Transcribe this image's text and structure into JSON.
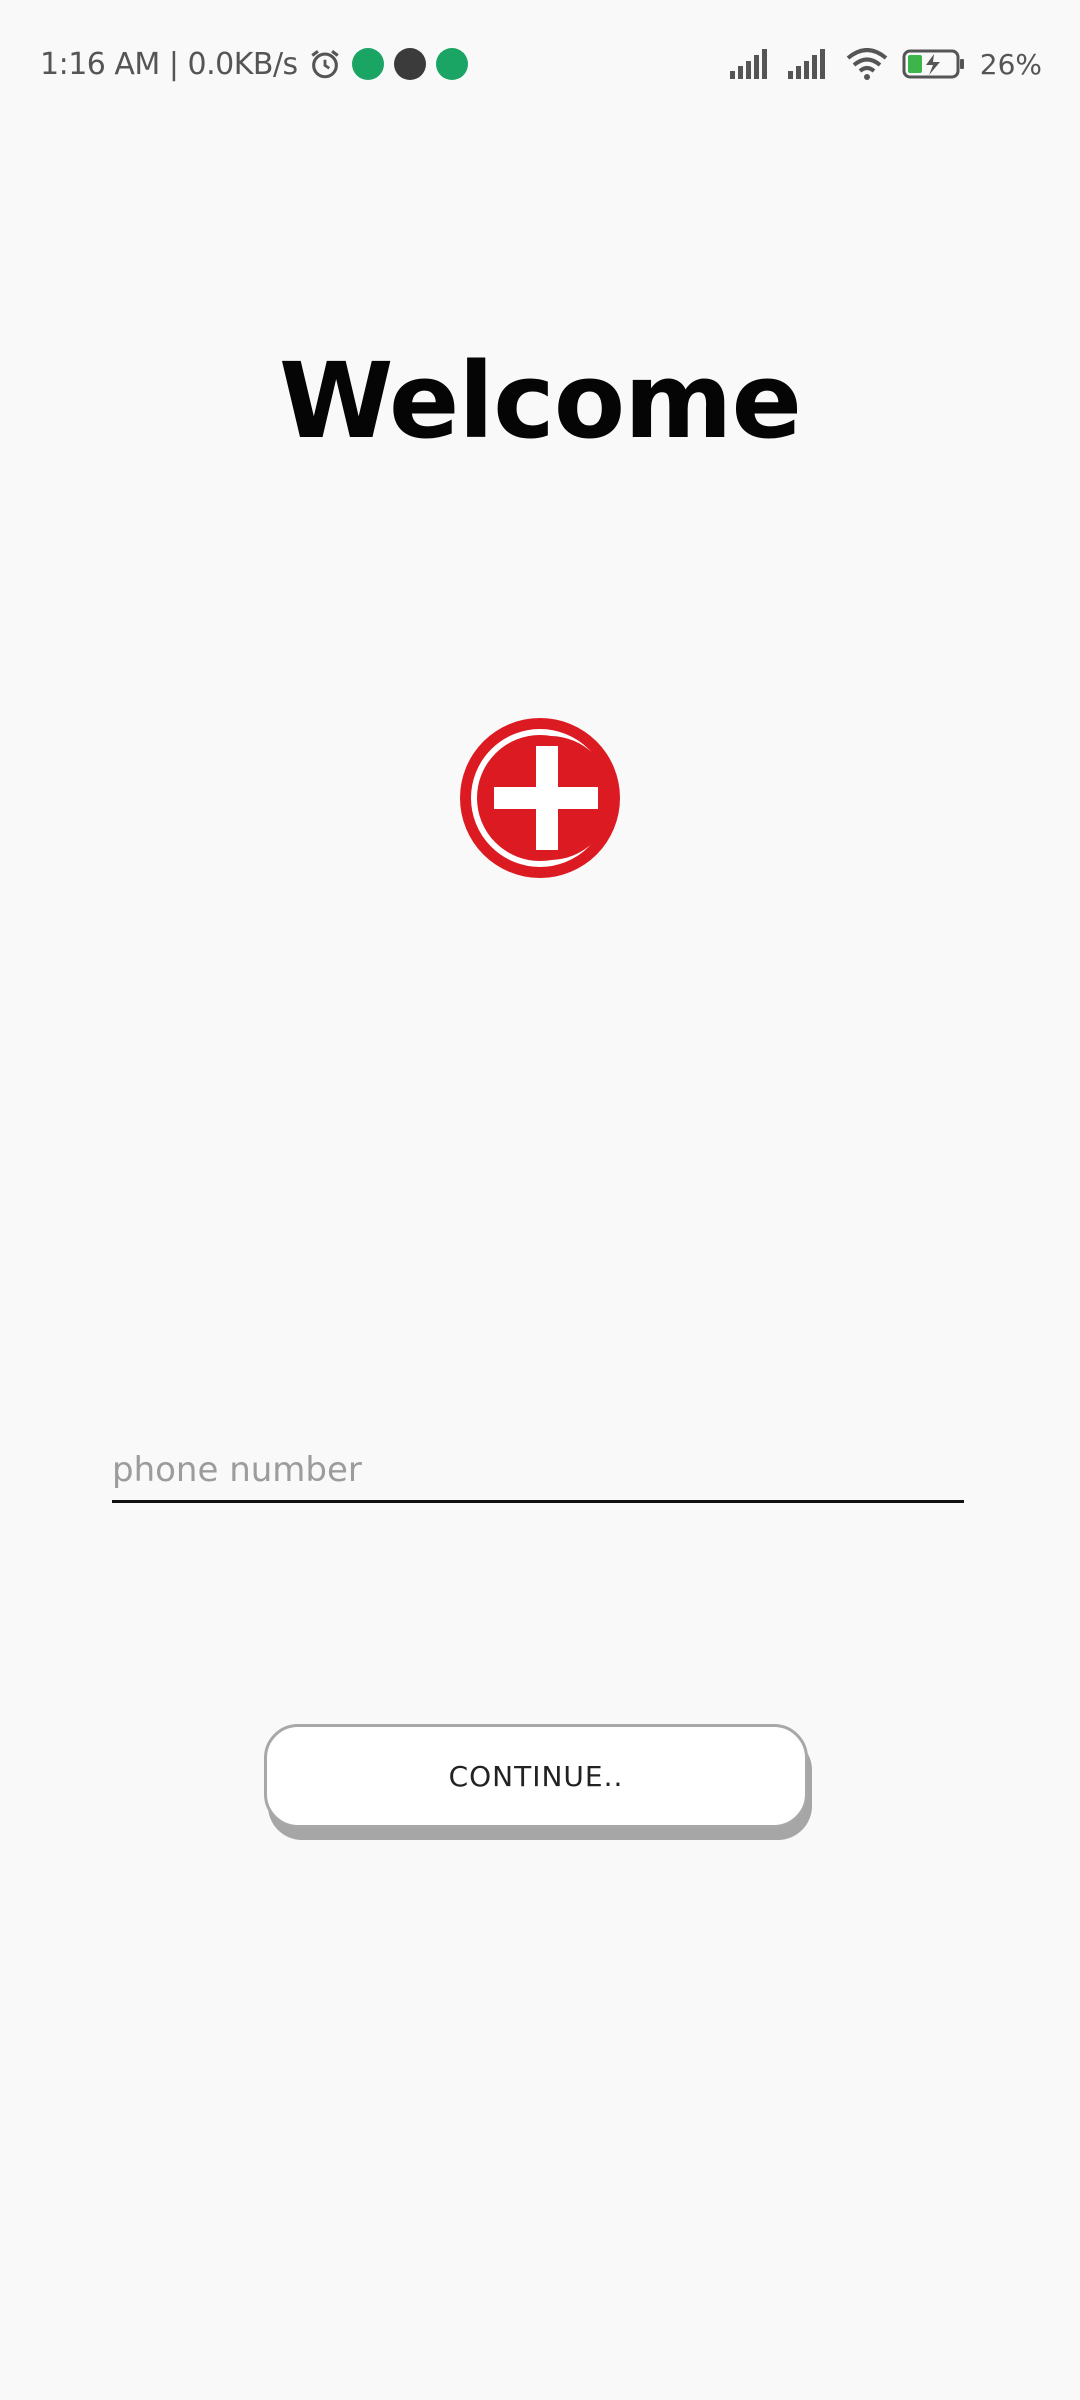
{
  "status_bar": {
    "left_text": "1:16 AM | 0.0KB/s",
    "battery_percent": "26%"
  },
  "main": {
    "title": "Welcome",
    "phone_input": {
      "value": "",
      "placeholder": "phone number"
    },
    "continue_label": "CONTINUE.."
  },
  "colors": {
    "logo_red": "#dc1a22",
    "background": "#f9f9f9"
  }
}
